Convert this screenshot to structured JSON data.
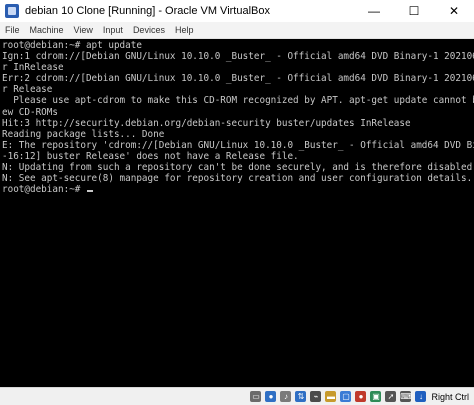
{
  "window": {
    "title": "debian 10 Clone [Running] - Oracle VM VirtualBox",
    "controls": {
      "minimize": "—",
      "maximize": "☐",
      "close": "✕"
    }
  },
  "menu": {
    "items": [
      {
        "label": "File"
      },
      {
        "label": "Machine"
      },
      {
        "label": "View"
      },
      {
        "label": "Input"
      },
      {
        "label": "Devices"
      },
      {
        "label": "Help"
      }
    ]
  },
  "terminal": {
    "lines": [
      "root@debian:~# apt update",
      "Ign:1 cdrom://[Debian GNU/Linux 10.10.0 _Buster_ - Official amd64 DVD Binary-1 20210619-16:12] buste",
      "r InRelease",
      "Err:2 cdrom://[Debian GNU/Linux 10.10.0 _Buster_ - Official amd64 DVD Binary-1 20210619-16:12] buste",
      "r Release",
      "  Please use apt-cdrom to make this CD-ROM recognized by APT. apt-get update cannot be used to add n",
      "ew CD-ROMs",
      "Hit:3 http://security.debian.org/debian-security buster/updates InRelease",
      "Reading package lists... Done",
      "E: The repository 'cdrom://[Debian GNU/Linux 10.10.0 _Buster_ - Official amd64 DVD Binary-1 20210619",
      "-16:12] buster Release' does not have a Release file.",
      "N: Updating from such a repository can't be done securely, and is therefore disabled by default.",
      "N: See apt-secure(8) manpage for repository creation and user configuration details."
    ],
    "prompt": "root@debian:~# "
  },
  "statusbar": {
    "icons": [
      {
        "name": "hard-disk-icon",
        "color": "#6b6b6b",
        "glyph": "▭"
      },
      {
        "name": "optical-drive-icon",
        "color": "#2f6fc4",
        "glyph": "●"
      },
      {
        "name": "audio-icon",
        "color": "#7a7a7a",
        "glyph": "♪"
      },
      {
        "name": "network-icon",
        "color": "#2f6fc4",
        "glyph": "⇅"
      },
      {
        "name": "usb-icon",
        "color": "#4b4b4b",
        "glyph": "⌁"
      },
      {
        "name": "shared-folders-icon",
        "color": "#c79a2c",
        "glyph": "▬"
      },
      {
        "name": "display-icon",
        "color": "#3a7bd5",
        "glyph": "▢"
      },
      {
        "name": "video-capture-icon",
        "color": "#c0392b",
        "glyph": "●"
      },
      {
        "name": "cpu-icon",
        "color": "#2e8b57",
        "glyph": "▣"
      },
      {
        "name": "mouse-integration-icon",
        "color": "#555555",
        "glyph": "➚"
      },
      {
        "name": "keyboard-icon",
        "color": "#555555",
        "glyph": "⌨"
      },
      {
        "name": "host-key-arrow-icon",
        "color": "#1f5fbf",
        "glyph": "↓"
      }
    ],
    "host_key": "Right Ctrl"
  }
}
